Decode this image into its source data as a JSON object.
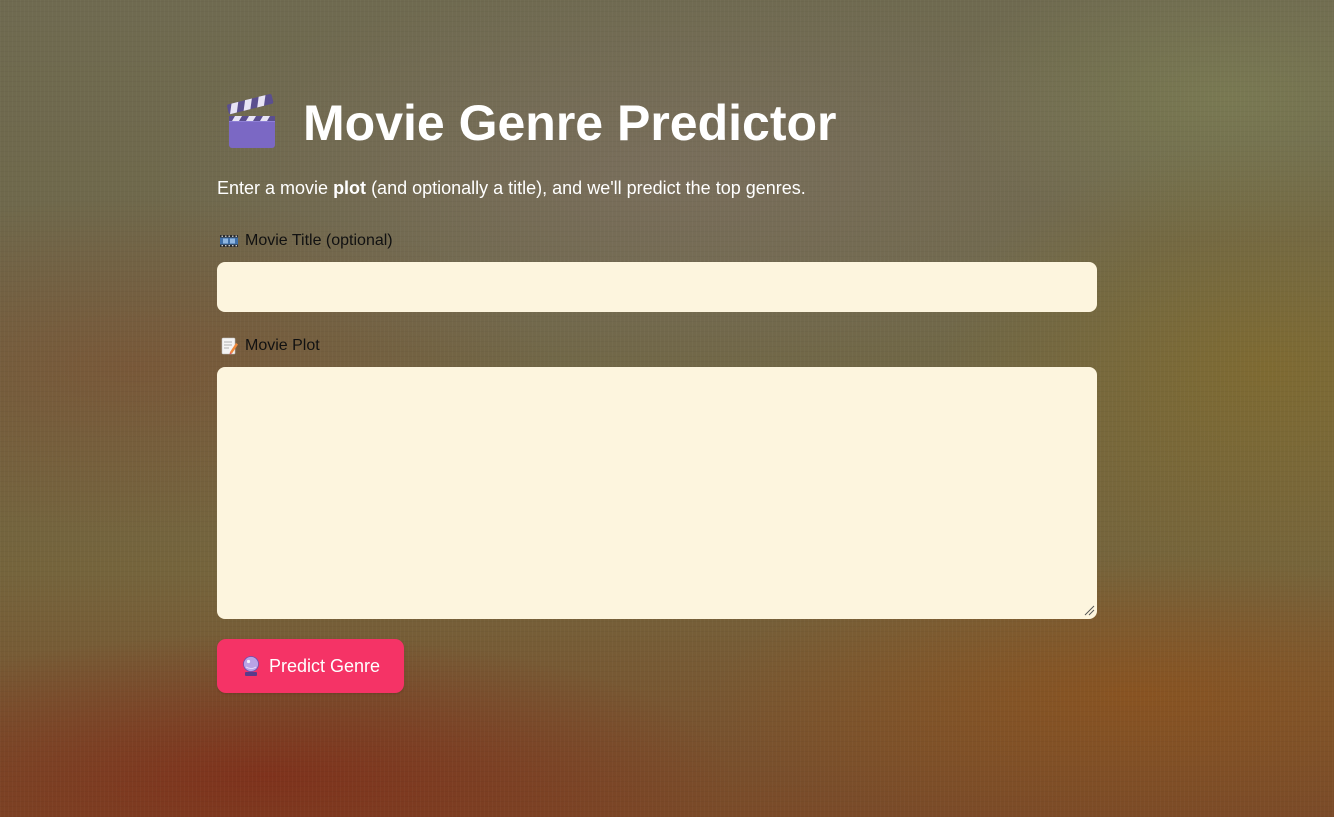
{
  "header": {
    "title": "Movie Genre Predictor",
    "icon": "clapper-board-icon"
  },
  "intro": {
    "before": "Enter a movie ",
    "bold": "plot",
    "after": " (and optionally a title), and we'll predict the top genres."
  },
  "title_field": {
    "label": "Movie Title (optional)",
    "icon": "film-frames-icon",
    "value": "",
    "placeholder": ""
  },
  "plot_field": {
    "label": "Movie Plot",
    "icon": "memo-icon",
    "value": "",
    "placeholder": ""
  },
  "predict_button": {
    "label": "Predict Genre",
    "icon": "crystal-ball-icon",
    "color": "#f53366"
  },
  "colors": {
    "input_background": "#fdf5de",
    "title_text": "#ffffff"
  }
}
